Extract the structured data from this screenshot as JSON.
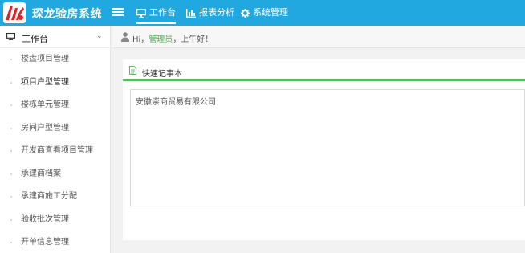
{
  "app": {
    "title": "琛龙验房系统"
  },
  "topnav": {
    "items": [
      {
        "label": "工作台",
        "icon": "monitor-icon"
      },
      {
        "label": "报表分析",
        "icon": "bar-chart-icon"
      },
      {
        "label": "系统管理",
        "icon": "gear-icon"
      }
    ]
  },
  "sidebar": {
    "header": "工作台",
    "items": [
      {
        "label": "楼盘项目管理"
      },
      {
        "label": "项目户型管理"
      },
      {
        "label": "楼栋单元管理"
      },
      {
        "label": "房间户型管理"
      },
      {
        "label": "开发商查看项目管理"
      },
      {
        "label": "承建商档案"
      },
      {
        "label": "承建商施工分配"
      },
      {
        "label": "验收批次管理"
      },
      {
        "label": "开单信息管理"
      }
    ]
  },
  "greeting": {
    "prefix": "Hi，",
    "user": "管理员",
    "suffix": "，上午好！"
  },
  "notepad": {
    "title": "快速记事本",
    "content": "安徽崇商贸易有限公司"
  },
  "colors": {
    "topbar": "#22a8e0",
    "accent_green": "#5cb85c",
    "logo_red": "#d9252a"
  }
}
